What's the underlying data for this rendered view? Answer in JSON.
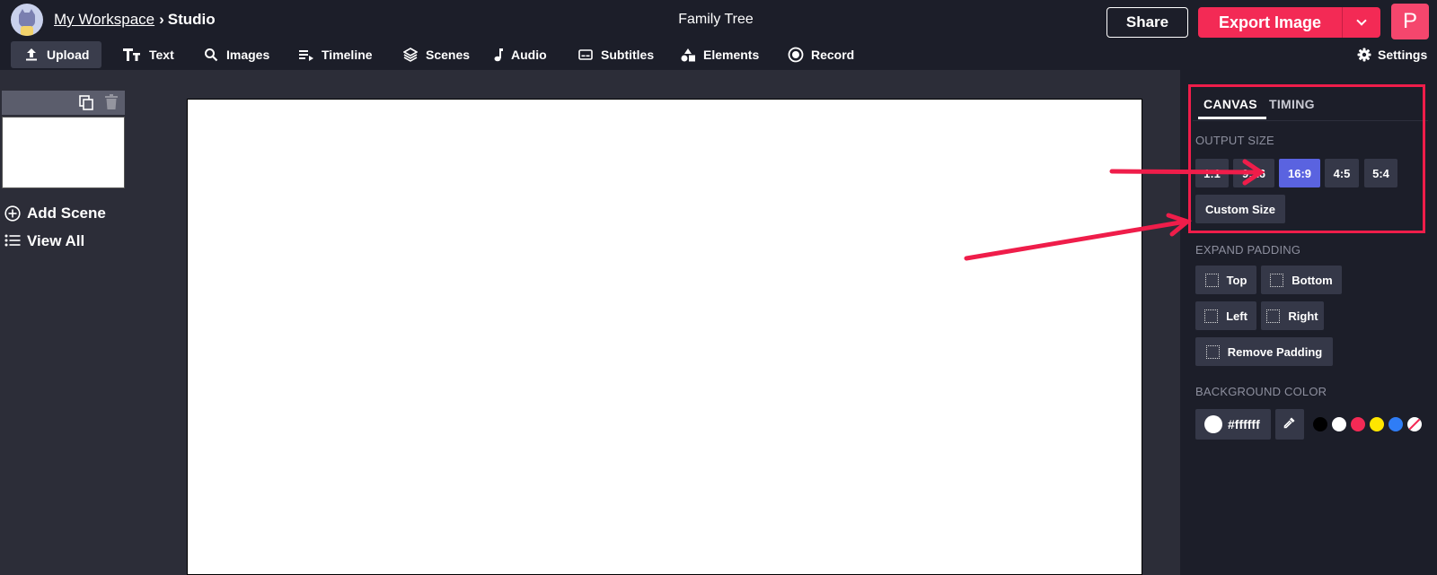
{
  "header": {
    "workspace_link": "My Workspace",
    "separator": "›",
    "current": "Studio",
    "project_title": "Family Tree",
    "share_label": "Share",
    "export_label": "Export Image",
    "avatar_letter": "P"
  },
  "toolbar": {
    "items": [
      {
        "label": "Upload",
        "icon": "upload-icon"
      },
      {
        "label": "Text",
        "icon": "text-icon"
      },
      {
        "label": "Images",
        "icon": "search-icon"
      },
      {
        "label": "Timeline",
        "icon": "timeline-icon"
      },
      {
        "label": "Scenes",
        "icon": "layers-icon"
      },
      {
        "label": "Audio",
        "icon": "music-note-icon"
      },
      {
        "label": "Subtitles",
        "icon": "subtitles-icon"
      },
      {
        "label": "Elements",
        "icon": "shapes-icon"
      },
      {
        "label": "Record",
        "icon": "record-icon"
      }
    ],
    "settings_label": "Settings"
  },
  "scenes_panel": {
    "add_scene": "Add Scene",
    "view_all": "View All"
  },
  "right_panel": {
    "tabs": [
      "CANVAS",
      "TIMING"
    ],
    "active_tab": "CANVAS",
    "output_size": {
      "label": "OUTPUT SIZE",
      "options": [
        "1:1",
        "9:16",
        "16:9",
        "4:5",
        "5:4"
      ],
      "selected": "16:9",
      "custom_label": "Custom Size"
    },
    "expand_padding": {
      "label": "EXPAND PADDING",
      "top": "Top",
      "bottom": "Bottom",
      "left": "Left",
      "right": "Right",
      "remove": "Remove Padding"
    },
    "background_color": {
      "label": "BACKGROUND COLOR",
      "value": "#ffffff",
      "presets": [
        "#000000",
        "#ffffff",
        "#f32a55",
        "#ffe600",
        "#2f7df6",
        "none"
      ]
    }
  },
  "colors": {
    "accent": "#f32a55",
    "selected": "#5a63e0",
    "annotation": "#ef1d4a"
  }
}
